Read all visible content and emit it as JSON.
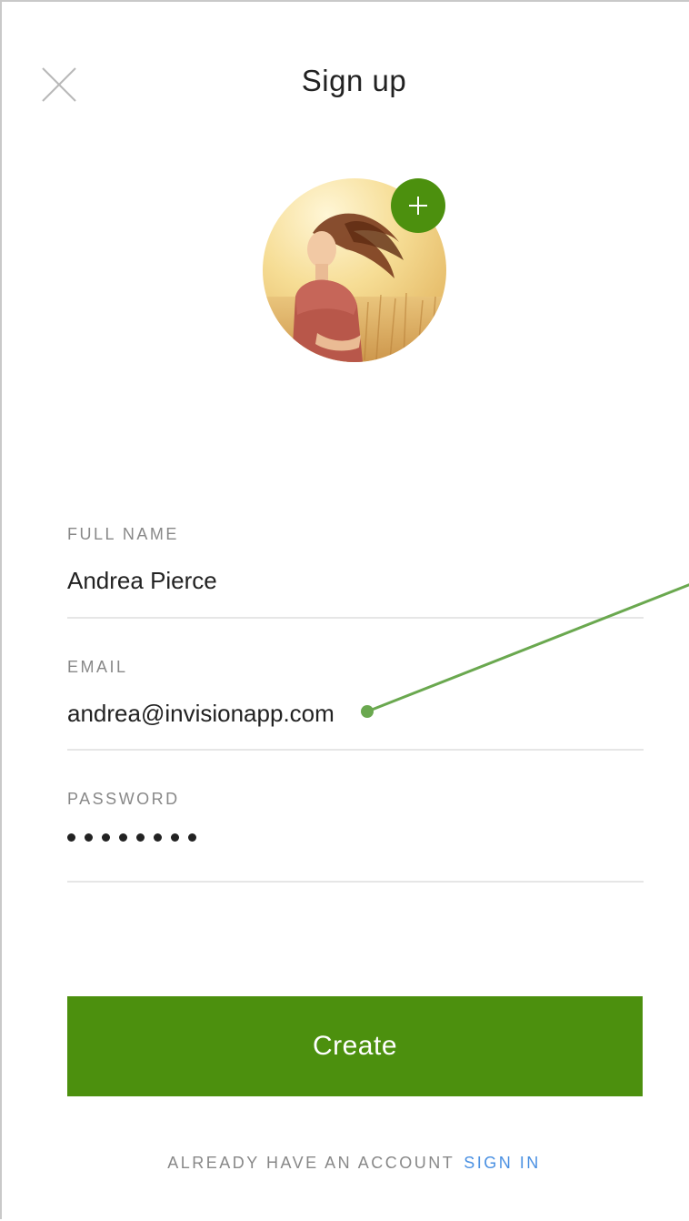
{
  "header": {
    "title": "Sign up",
    "close_icon": "close-icon"
  },
  "avatar": {
    "add_icon": "plus-icon",
    "accent_color": "#4c900e"
  },
  "form": {
    "full_name": {
      "label": "FULL NAME",
      "value": "Andrea Pierce"
    },
    "email": {
      "label": "EMAIL",
      "value": "andrea@invisionapp.com"
    },
    "password": {
      "label": "PASSWORD",
      "masked_length": 8
    }
  },
  "actions": {
    "create_label": "Create",
    "button_color": "#4c900e"
  },
  "footer": {
    "prompt": "ALREADY HAVE AN ACCOUNT",
    "sign_in_label": "SIGN IN",
    "link_color": "#4a90e2"
  }
}
